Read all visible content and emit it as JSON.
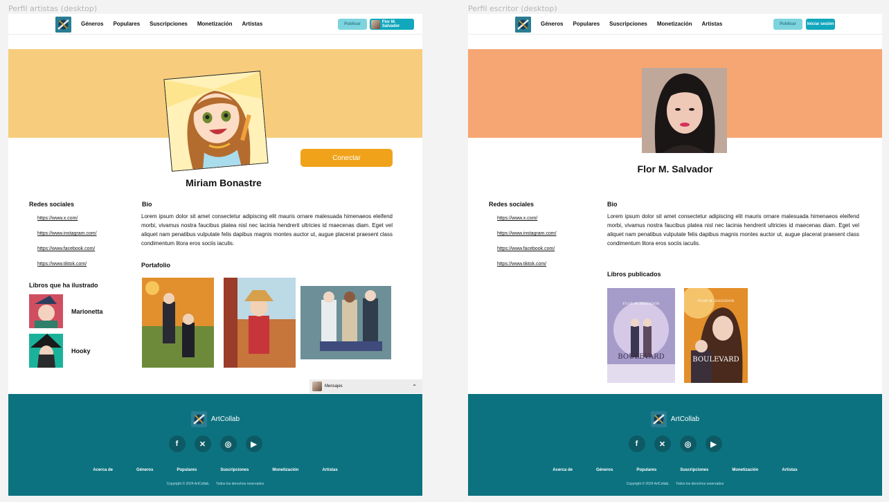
{
  "frames": {
    "artist_label": "Perfil artistas (desktop)",
    "writer_label": "Perfil escritor (desktop)"
  },
  "nav": {
    "links": [
      "Géneros",
      "Populares",
      "Suscripciones",
      "Monetización",
      "Artistas"
    ],
    "publish": "Publicar",
    "user_name": "Flor M. Salvador",
    "login": "Iniciar sesión"
  },
  "artist": {
    "name": "Miriam Bonastre",
    "connect": "Conectar",
    "social_title": "Redes sociales",
    "socials": [
      "https://www.x.com/",
      "https://www.instagram.com/",
      "https://www.facebook.com/",
      "https://www.tiktok.com/"
    ],
    "bio_title": "Bio",
    "bio": "Lorem ipsum dolor sit amet consectetur adipiscing elit mauris ornare malesuada himenaeos eleifend morbi, vivamus nostra faucibus platea nisl nec lacinia hendrerit ultricies id maecenas diam. Eget vel aliquet nam penatibus vulputate felis dapibus magnis montes auctor ut, augue placerat praesent class condimentum litora eros sociis iaculis.",
    "books_title": "Libros que ha ilustrado",
    "books": [
      "Marionetta",
      "Hooky"
    ],
    "portfolio_title": "Portafolio",
    "messages": "Mensajes"
  },
  "writer": {
    "name": "Flor M. Salvador",
    "social_title": "Redes sociales",
    "socials": [
      "https://www.x.com/",
      "https://www.instagram.com/",
      "https://www.facebook.com/",
      "https://www.tiktok.com/"
    ],
    "bio_title": "Bio",
    "bio": "Lorem ipsum dolor sit amet consectetur adipiscing elit mauris ornare malesuada himenaeos eleifend morbi, vivamus nostra faucibus platea nisl nec lacinia hendrerit ultricies id maecenas diam. Eget vel aliquet nam penatibus vulputate felis dapibus magnis montes auctor ut, augue placerat praesent class condimentum litora eros sociis iaculis.",
    "books_title": "Libros publicados",
    "covers": [
      {
        "author": "FLOR M. SALVADOR",
        "title": "BOULEVARD"
      },
      {
        "author": "FLOR M. SALVADOR",
        "title": "BOULEVARD"
      }
    ]
  },
  "footer": {
    "brand": "ArtCollab",
    "social_icons": [
      "facebook-icon",
      "x-icon",
      "instagram-icon",
      "youtube-icon"
    ],
    "links": [
      "Acerca de",
      "Géneros",
      "Populares",
      "Suscripciones",
      "Monetización",
      "Artistas"
    ],
    "copyright": "Copyright © 2024 ArtCollab.",
    "rights": "Todos los derechos reservados"
  },
  "colors": {
    "artist_banner": "#f7cc7c",
    "writer_banner": "#f6a673",
    "accent": "#11a7bd",
    "connect": "#f0a31a",
    "footer": "#0c7280"
  }
}
